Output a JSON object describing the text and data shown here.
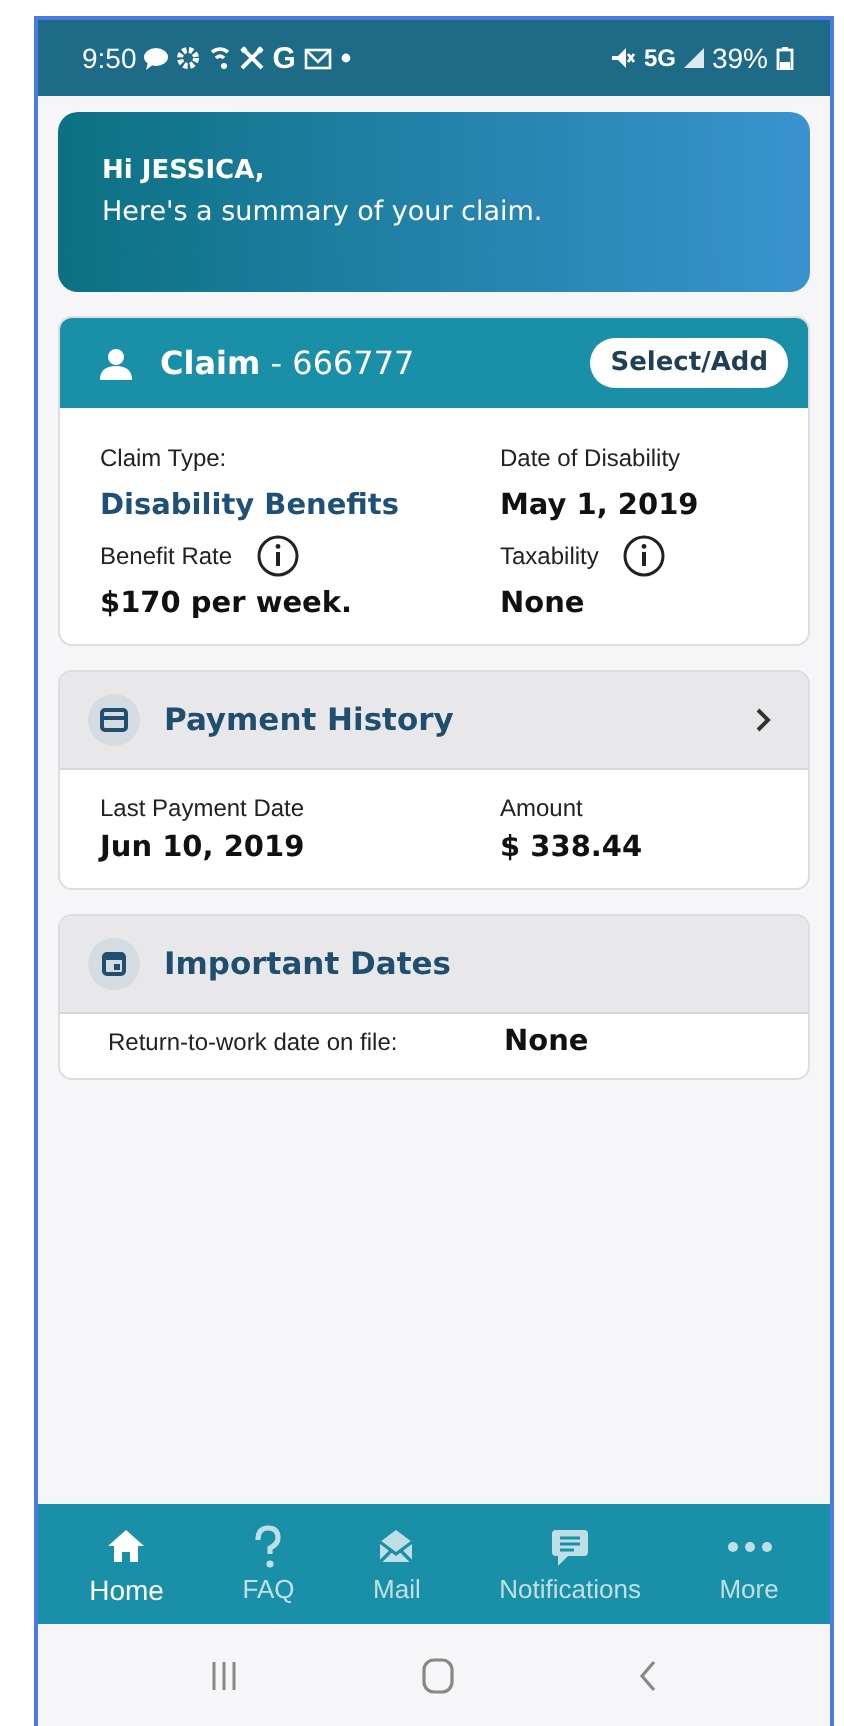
{
  "status_bar": {
    "time": "9:50",
    "app_letter": "G",
    "network": "5G",
    "battery": "39%"
  },
  "greeting": {
    "title": "Hi JESSICA,",
    "subtitle": "Here's a summary of your claim."
  },
  "claim": {
    "title": "**Claim** - 666777",
    "button": "Select/Add",
    "fields": [
      {
        "label": "Claim Type:",
        "value": "Disability Benefits",
        "kind": "link",
        "info": false
      },
      {
        "label": "Date of Disability",
        "value": "May 1, 2019",
        "kind": "plain",
        "info": false
      },
      {
        "label": "Benefit Rate",
        "value": "$170 per week.",
        "kind": "plain",
        "info": true
      },
      {
        "label": "Taxability",
        "value": "None",
        "kind": "plain",
        "info": true
      }
    ]
  },
  "sections": [
    {
      "kind": "card",
      "title": "Payment History",
      "chevron": true,
      "fields": [
        {
          "label": "Last Payment Date",
          "value": "Jun 10, 2019"
        },
        {
          "label": "Amount",
          "value": "$ 338.44"
        }
      ]
    },
    {
      "kind": "calendar",
      "title": "Important Dates",
      "chevron": false,
      "fields": [
        {
          "label": "Return-to-work date on file:",
          "value": "None"
        }
      ]
    }
  ],
  "nav": {
    "items": [
      {
        "kind": "home",
        "label": "Home",
        "selected": true
      },
      {
        "kind": "faq",
        "label": "FAQ",
        "selected": false
      },
      {
        "kind": "mail",
        "label": "Mail",
        "selected": false
      },
      {
        "kind": "notifications",
        "label": "Notifications",
        "selected": false
      },
      {
        "kind": "more",
        "label": "More",
        "selected": false
      }
    ]
  }
}
